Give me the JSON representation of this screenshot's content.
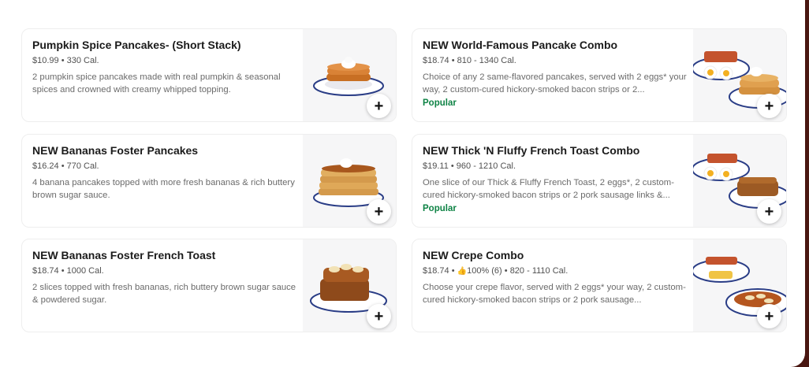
{
  "menu": {
    "items": [
      {
        "title": "Pumpkin Spice Pancakes- (Short Stack)",
        "price": "$10.99",
        "separator": " • ",
        "calories": "330 Cal.",
        "description": "2 pumpkin spice pancakes made with real pumpkin & seasonal spices and crowned with creamy whipped topping.",
        "badge": ""
      },
      {
        "title": "NEW World-Famous Pancake Combo",
        "price": "$18.74",
        "separator": " • ",
        "calories": "810 - 1340 Cal.",
        "description": "Choice of any 2 same-flavored pancakes, served with 2 eggs* your way, 2 custom-cured hickory-smoked bacon strips or 2...",
        "badge": "Popular"
      },
      {
        "title": "NEW Bananas Foster Pancakes",
        "price": "$16.24",
        "separator": " • ",
        "calories": "770 Cal.",
        "description": "4 banana pancakes topped with more fresh bananas & rich buttery brown sugar sauce.",
        "badge": ""
      },
      {
        "title": "NEW Thick 'N Fluffy French Toast Combo",
        "price": "$19.11",
        "separator": " • ",
        "calories": "960 - 1210 Cal.",
        "description": "One slice of our Thick & Fluffy French Toast, 2 eggs*, 2 custom-cured hickory-smoked bacon strips or 2 pork sausage links &...",
        "badge": "Popular"
      },
      {
        "title": "NEW Bananas Foster French Toast",
        "price": "$18.74",
        "separator": " • ",
        "calories": "1000 Cal.",
        "description": "2 slices topped with fresh bananas, rich buttery brown sugar sauce & powdered sugar.",
        "badge": ""
      },
      {
        "title": "NEW Crepe Combo",
        "price": "$18.74",
        "separator": " • ",
        "rating_icon": "thumbs-up-icon",
        "rating": "100% (6)",
        "calories": "820 - 1110 Cal.",
        "description": "Choose your crepe flavor, served with 2 eggs* your way, 2 custom-cured hickory-smoked bacon strips or 2 pork sausage...",
        "badge": ""
      }
    ],
    "add_button_label": "+",
    "add_icon": "plus-icon"
  },
  "colors": {
    "popular_badge": "#0e8345",
    "outer_background": "#4a1712"
  }
}
